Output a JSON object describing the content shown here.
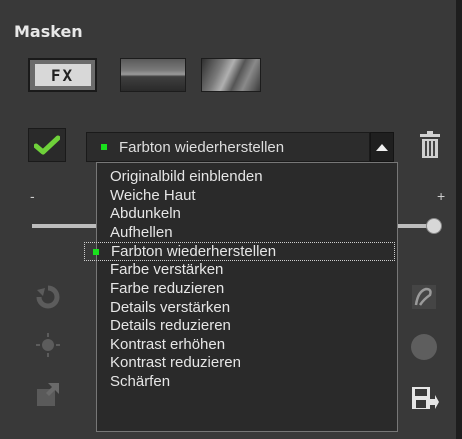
{
  "panel": {
    "title": "Masken",
    "fx_label": "FX"
  },
  "mask_select": {
    "selected": "Farbton wiederherstellen",
    "indicator_color": "#19e01c"
  },
  "slider": {
    "min_label": "-",
    "max_label": "+",
    "value": 1.0
  },
  "dropdown": {
    "items": [
      "Originalbild einblenden",
      "Weiche Haut",
      "Abdunkeln",
      "Aufhellen",
      "Farbton wiederherstellen",
      "Farbe verstärken",
      "Farbe reduzieren",
      "Details verstärken",
      "Details reduzieren",
      "Kontrast erhöhen",
      "Kontrast reduzieren",
      "Schärfen"
    ]
  },
  "icons": {
    "check": "check-icon",
    "trash": "trash-icon",
    "undo": "undo-icon",
    "brush_settings": "brush-settings-icon",
    "export": "export-icon",
    "eraser": "eraser-icon",
    "circle_brush": "circle-brush-icon",
    "save": "save-icon"
  }
}
